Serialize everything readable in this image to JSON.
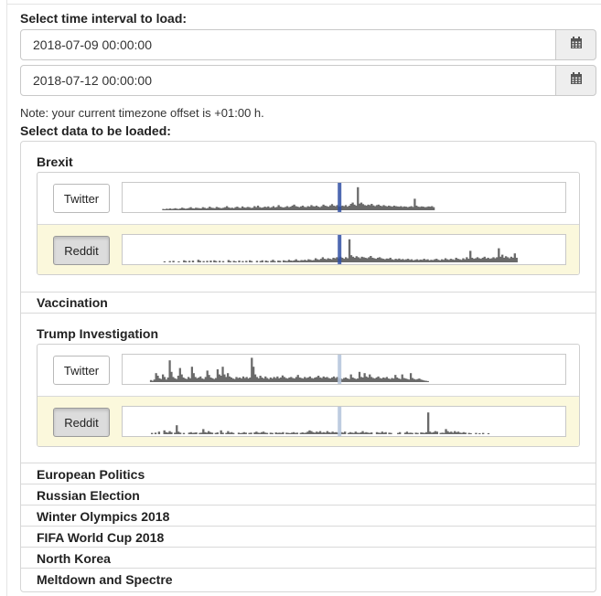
{
  "interval": {
    "label": "Select time interval to load:",
    "start": "2018-07-09 00:00:00",
    "end": "2018-07-12 00:00:00",
    "icon": "calendar-icon"
  },
  "note": "Note: your current timezone offset is +01:00 h.",
  "data_label": "Select data to be loaded:",
  "colors": {
    "bar": "#6a6a6a",
    "marker_strong": "#2f4fa3",
    "marker_light": "#b7c6dd",
    "selected_row": "#fbf8dc"
  },
  "topics": [
    {
      "name": "Brexit",
      "expanded": true,
      "marker_style": "strong",
      "sources": [
        {
          "label": "Twitter",
          "selected": false,
          "marker": 0.49,
          "series": [
            0,
            0,
            0,
            0,
            0,
            0,
            0,
            0,
            0,
            0,
            0,
            0,
            0,
            0,
            0,
            0,
            0,
            0,
            0,
            0,
            0,
            0,
            0,
            0.05,
            0.04,
            0.06,
            0.05,
            0.07,
            0.05,
            0.06,
            0.08,
            0.06,
            0.05,
            0.07,
            0.1,
            0.08,
            0.06,
            0.07,
            0.09,
            0.12,
            0.08,
            0.07,
            0.1,
            0.09,
            0.08,
            0.07,
            0.12,
            0.1,
            0.07,
            0.09,
            0.14,
            0.1,
            0.09,
            0.08,
            0.13,
            0.11,
            0.09,
            0.08,
            0.1,
            0.12,
            0.16,
            0.11,
            0.09,
            0.1,
            0.08,
            0.12,
            0.14,
            0.1,
            0.09,
            0.15,
            0.11,
            0.1,
            0.13,
            0.12,
            0.09,
            0.1,
            0.16,
            0.12,
            0.18,
            0.12,
            0.1,
            0.11,
            0.14,
            0.12,
            0.15,
            0.1,
            0.12,
            0.16,
            0.11,
            0.13,
            0.2,
            0.14,
            0.12,
            0.11,
            0.13,
            0.16,
            0.12,
            0.14,
            0.18,
            0.22,
            0.16,
            0.14,
            0.12,
            0.15,
            0.18,
            0.13,
            0.12,
            0.16,
            0.14,
            0.2,
            0.16,
            0.15,
            0.18,
            0.14,
            0.12,
            0.16,
            0.22,
            0.18,
            0.16,
            0.14,
            0.19,
            0.24,
            0.18,
            0.16,
            0.2,
            0.15,
            0.14,
            0.18,
            0.16,
            0.2,
            0.14,
            0.18,
            0.25,
            0.3,
            0.22,
            0.18,
            0.9,
            0.26,
            0.3,
            0.24,
            0.2,
            0.18,
            0.22,
            0.2,
            0.25,
            0.19,
            0.16,
            0.2,
            0.22,
            0.18,
            0.16,
            0.2,
            0.17,
            0.15,
            0.18,
            0.16,
            0.14,
            0.18,
            0.16,
            0.15,
            0.14,
            0.16,
            0.13,
            0.15,
            0.14,
            0.12,
            0.14,
            0.16,
            0.13,
            0.45,
            0.18,
            0.14,
            0.13,
            0.15,
            0.14,
            0.12,
            0.13,
            0.15,
            0.14,
            0.16,
            0.12,
            0,
            0,
            0,
            0,
            0,
            0,
            0,
            0,
            0,
            0,
            0,
            0,
            0,
            0,
            0,
            0,
            0,
            0,
            0,
            0,
            0,
            0,
            0,
            0,
            0,
            0,
            0,
            0,
            0,
            0,
            0,
            0,
            0,
            0,
            0,
            0,
            0,
            0,
            0,
            0,
            0,
            0,
            0,
            0,
            0,
            0,
            0,
            0,
            0,
            0,
            0,
            0,
            0,
            0,
            0,
            0,
            0,
            0,
            0,
            0,
            0,
            0,
            0,
            0,
            0,
            0,
            0,
            0,
            0,
            0,
            0,
            0,
            0,
            0,
            0,
            0
          ]
        },
        {
          "label": "Reddit",
          "selected": true,
          "marker": 0.49,
          "series": [
            0,
            0,
            0,
            0,
            0,
            0,
            0,
            0,
            0,
            0,
            0,
            0,
            0,
            0,
            0,
            0,
            0,
            0,
            0,
            0,
            0,
            0,
            0,
            0.04,
            0,
            0,
            0.05,
            0,
            0.06,
            0,
            0,
            0.04,
            0,
            0,
            0.08,
            0.05,
            0,
            0.06,
            0,
            0.07,
            0,
            0,
            0.1,
            0.06,
            0,
            0.05,
            0,
            0.06,
            0,
            0.07,
            0,
            0.08,
            0.05,
            0,
            0.06,
            0,
            0.05,
            0,
            0,
            0.09,
            0.05,
            0,
            0.06,
            0.04,
            0,
            0.07,
            0,
            0.05,
            0,
            0.06,
            0,
            0.08,
            0.05,
            0,
            0,
            0.06,
            0,
            0.05,
            0.08,
            0,
            0.07,
            0.05,
            0,
            0.06,
            0.1,
            0.05,
            0,
            0.07,
            0.06,
            0,
            0.08,
            0.06,
            0.05,
            0.1,
            0.07,
            0.06,
            0.08,
            0.12,
            0.07,
            0.06,
            0.09,
            0.08,
            0.1,
            0.07,
            0.12,
            0.1,
            0.08,
            0.09,
            0.16,
            0.12,
            0.1,
            0.14,
            0.2,
            0.14,
            0.12,
            0.16,
            0.14,
            0.12,
            0.18,
            0.16,
            0.2,
            0.15,
            0.22,
            0.18,
            0.14,
            0.2,
            0.16,
            0.9,
            0.28,
            0.22,
            0.18,
            0.24,
            0.2,
            0.16,
            0.22,
            0.2,
            0.18,
            0.16,
            0.2,
            0.25,
            0.18,
            0.16,
            0.14,
            0.18,
            0.2,
            0.16,
            0.14,
            0.12,
            0.15,
            0.14,
            0.18,
            0.12,
            0.1,
            0.14,
            0.12,
            0.15,
            0.11,
            0.13,
            0.1,
            0.12,
            0.14,
            0.1,
            0.12,
            0.08,
            0.1,
            0.12,
            0.09,
            0.11,
            0.1,
            0.14,
            0.1,
            0.12,
            0.08,
            0.1,
            0.09,
            0.12,
            0.14,
            0.1,
            0.08,
            0.12,
            0.1,
            0.16,
            0.12,
            0.1,
            0.14,
            0.12,
            0.1,
            0.18,
            0.14,
            0.12,
            0.1,
            0.16,
            0.12,
            0.2,
            0.14,
            0.45,
            0.18,
            0.14,
            0.16,
            0.2,
            0.16,
            0.14,
            0.18,
            0.22,
            0.15,
            0.18,
            0.14,
            0.16,
            0.2,
            0.16,
            0.2,
            0.55,
            0.22,
            0.3,
            0.18,
            0.24,
            0.2,
            0.16,
            0.22,
            0.18,
            0.35,
            0.18,
            0,
            0,
            0,
            0,
            0,
            0,
            0,
            0,
            0,
            0,
            0,
            0,
            0,
            0,
            0,
            0,
            0,
            0,
            0,
            0,
            0,
            0,
            0,
            0,
            0,
            0,
            0
          ]
        }
      ]
    },
    {
      "name": "Vaccination",
      "expanded": false
    },
    {
      "name": "Trump Investigation",
      "expanded": true,
      "marker_style": "light",
      "sources": [
        {
          "label": "Twitter",
          "selected": false,
          "marker": 0.49,
          "series": [
            0,
            0,
            0,
            0,
            0,
            0,
            0,
            0,
            0,
            0,
            0,
            0,
            0,
            0,
            0,
            0,
            0.08,
            0.05,
            0.1,
            0.35,
            0.25,
            0.15,
            0.12,
            0.3,
            0.2,
            0.1,
            0.18,
            0.85,
            0.4,
            0.2,
            0.15,
            0.12,
            0.25,
            0.55,
            0.3,
            0.18,
            0.14,
            0.12,
            0.2,
            0.15,
            0.6,
            0.35,
            0.2,
            0.15,
            0.18,
            0.22,
            0.14,
            0.12,
            0.2,
            0.45,
            0.28,
            0.18,
            0.15,
            0.12,
            0.16,
            0.5,
            0.3,
            0.25,
            0.6,
            0.3,
            0.2,
            0.35,
            0.22,
            0.18,
            0.14,
            0.12,
            0.2,
            0.16,
            0.18,
            0.14,
            0.22,
            0.16,
            0.2,
            0.14,
            0.18,
            0.95,
            0.6,
            0.3,
            0.2,
            0.15,
            0.25,
            0.18,
            0.14,
            0.22,
            0.16,
            0.12,
            0.18,
            0.14,
            0.2,
            0.16,
            0.22,
            0.15,
            0.18,
            0.26,
            0.2,
            0.16,
            0.14,
            0.18,
            0.2,
            0.16,
            0.14,
            0.2,
            0.28,
            0.18,
            0.16,
            0.14,
            0.2,
            0.16,
            0.18,
            0.22,
            0.16,
            0.14,
            0.18,
            0.2,
            0.25,
            0.18,
            0.16,
            0.22,
            0.18,
            0.2,
            0.16,
            0.14,
            0.18,
            0.22,
            0.16,
            0.2,
            0.16,
            0.14,
            0.12,
            0.16,
            0.18,
            0.14,
            0.12,
            0.3,
            0.18,
            0.15,
            0.12,
            0.14,
            0.4,
            0.2,
            0.18,
            0.35,
            0.22,
            0.18,
            0.3,
            0.2,
            0.16,
            0.14,
            0.18,
            0.22,
            0.16,
            0.14,
            0.18,
            0.16,
            0.2,
            0.14,
            0.12,
            0.16,
            0.14,
            0.28,
            0.18,
            0.14,
            0.12,
            0.3,
            0.16,
            0.14,
            0.12,
            0.1,
            0.35,
            0.16,
            0.12,
            0.1,
            0.12,
            0.14,
            0.1,
            0.08,
            0.06,
            0.05,
            0.04,
            0,
            0,
            0,
            0,
            0,
            0,
            0,
            0,
            0,
            0,
            0,
            0,
            0,
            0,
            0,
            0,
            0,
            0,
            0,
            0,
            0,
            0,
            0,
            0,
            0,
            0,
            0,
            0,
            0,
            0,
            0,
            0,
            0,
            0,
            0,
            0,
            0,
            0,
            0,
            0,
            0,
            0,
            0,
            0,
            0,
            0,
            0,
            0,
            0,
            0,
            0,
            0,
            0,
            0,
            0,
            0,
            0,
            0,
            0,
            0,
            0,
            0,
            0,
            0,
            0,
            0,
            0,
            0,
            0,
            0,
            0,
            0,
            0,
            0,
            0,
            0,
            0,
            0,
            0,
            0
          ]
        },
        {
          "label": "Reddit",
          "selected": true,
          "marker": 0.49,
          "series": [
            0,
            0,
            0,
            0,
            0,
            0,
            0,
            0,
            0,
            0,
            0,
            0,
            0,
            0,
            0,
            0,
            0.05,
            0,
            0.06,
            0,
            0.1,
            0,
            0,
            0.15,
            0.08,
            0.06,
            0.12,
            0.08,
            0,
            0.06,
            0.35,
            0.1,
            0.06,
            0,
            0.05,
            0,
            0,
            0.06,
            0.08,
            0.05,
            0.06,
            0.07,
            0,
            0.05,
            0.06,
            0.2,
            0.08,
            0.06,
            0.12,
            0.08,
            0.06,
            0,
            0.05,
            0.07,
            0,
            0.15,
            0.06,
            0,
            0.05,
            0.12,
            0.06,
            0.08,
            0.05,
            0,
            0,
            0.06,
            0.04,
            0.05,
            0.08,
            0.06,
            0,
            0.05,
            0.06,
            0,
            0.07,
            0.1,
            0.06,
            0.05,
            0.08,
            0.1,
            0.06,
            0.05,
            0,
            0.06,
            0.05,
            0,
            0.07,
            0.05,
            0.06,
            0.05,
            0.08,
            0,
            0.06,
            0.05,
            0.04,
            0.06,
            0.08,
            0.05,
            0.06,
            0,
            0.05,
            0.07,
            0.05,
            0.06,
            0.1,
            0.15,
            0.12,
            0.08,
            0.06,
            0.1,
            0.08,
            0.12,
            0.06,
            0.08,
            0.06,
            0.12,
            0.08,
            0.06,
            0.1,
            0.07,
            0.08,
            0.06,
            0.05,
            0.08,
            0.06,
            0.1,
            0,
            0.05,
            0.08,
            0.06,
            0.05,
            0.1,
            0.06,
            0.05,
            0.07,
            0.12,
            0.06,
            0.08,
            0.06,
            0.05,
            0.07,
            0,
            0,
            0.08,
            0.06,
            0.05,
            0.1,
            0.06,
            0.08,
            0,
            0.06,
            0.05,
            0,
            0,
            0,
            0.05,
            0.08,
            0,
            0,
            0.06,
            0.1,
            0.05,
            0.06,
            0.05,
            0,
            0.06,
            0.05,
            0,
            0.07,
            0.06,
            0.05,
            0.08,
            0.85,
            0.1,
            0.06,
            0.08,
            0.12,
            0.1,
            0,
            0.05,
            0.06,
            0.05,
            0.2,
            0.12,
            0.08,
            0.1,
            0.06,
            0.12,
            0.08,
            0.1,
            0.06,
            0.05,
            0.08,
            0.06,
            0,
            0.05,
            0.04,
            0,
            0,
            0.05,
            0,
            0.04,
            0,
            0.05,
            0,
            0,
            0.04,
            0,
            0,
            0,
            0,
            0,
            0,
            0,
            0,
            0,
            0,
            0,
            0,
            0,
            0,
            0,
            0,
            0,
            0,
            0,
            0,
            0,
            0,
            0,
            0,
            0,
            0,
            0,
            0,
            0,
            0,
            0,
            0,
            0,
            0,
            0,
            0,
            0,
            0,
            0,
            0,
            0,
            0,
            0
          ]
        }
      ]
    },
    {
      "name": "European Politics",
      "expanded": false
    },
    {
      "name": "Russian Election",
      "expanded": false
    },
    {
      "name": "Winter Olympics 2018",
      "expanded": false
    },
    {
      "name": "FIFA World Cup 2018",
      "expanded": false
    },
    {
      "name": "North Korea",
      "expanded": false
    },
    {
      "name": "Meltdown and Spectre",
      "expanded": false
    }
  ]
}
